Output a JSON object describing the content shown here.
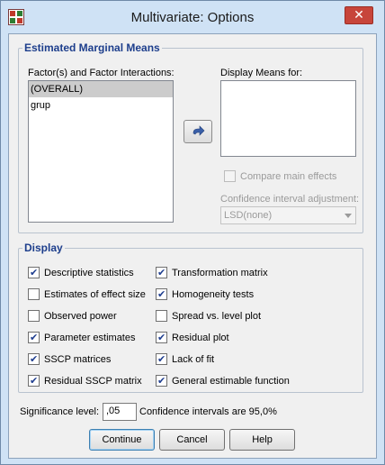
{
  "window": {
    "title": "Multivariate: Options",
    "close_glyph": "✕"
  },
  "emm": {
    "group_title": "Estimated Marginal Means",
    "factors_label": "Factor(s) and Factor Interactions:",
    "factors": [
      "(OVERALL)",
      "grup"
    ],
    "display_means_label": "Display Means for:",
    "compare_label": "Compare main effects",
    "ci_label": "Confidence interval adjustment:",
    "ci_value": "LSD(none)"
  },
  "display": {
    "group_title": "Display",
    "left": [
      {
        "label": "Descriptive statistics",
        "checked": true
      },
      {
        "label": "Estimates of effect size",
        "checked": false
      },
      {
        "label": "Observed power",
        "checked": false
      },
      {
        "label": "Parameter estimates",
        "checked": true
      },
      {
        "label": "SSCP matrices",
        "checked": true
      },
      {
        "label": "Residual SSCP matrix",
        "checked": true
      }
    ],
    "right": [
      {
        "label": "Transformation matrix",
        "checked": true
      },
      {
        "label": "Homogeneity tests",
        "checked": true
      },
      {
        "label": "Spread vs. level plot",
        "checked": false
      },
      {
        "label": "Residual plot",
        "checked": true
      },
      {
        "label": "Lack of fit",
        "checked": true
      },
      {
        "label": "General estimable function",
        "checked": true
      }
    ]
  },
  "significance": {
    "label": "Significance level:",
    "value": ",05",
    "ci_text": "Confidence intervals are 95,0%"
  },
  "buttons": {
    "continue": "Continue",
    "cancel": "Cancel",
    "help": "Help"
  },
  "icons": {
    "app": "spss-dialog-icon",
    "move": "arrow-right-icon",
    "check": "checkmark-icon"
  }
}
